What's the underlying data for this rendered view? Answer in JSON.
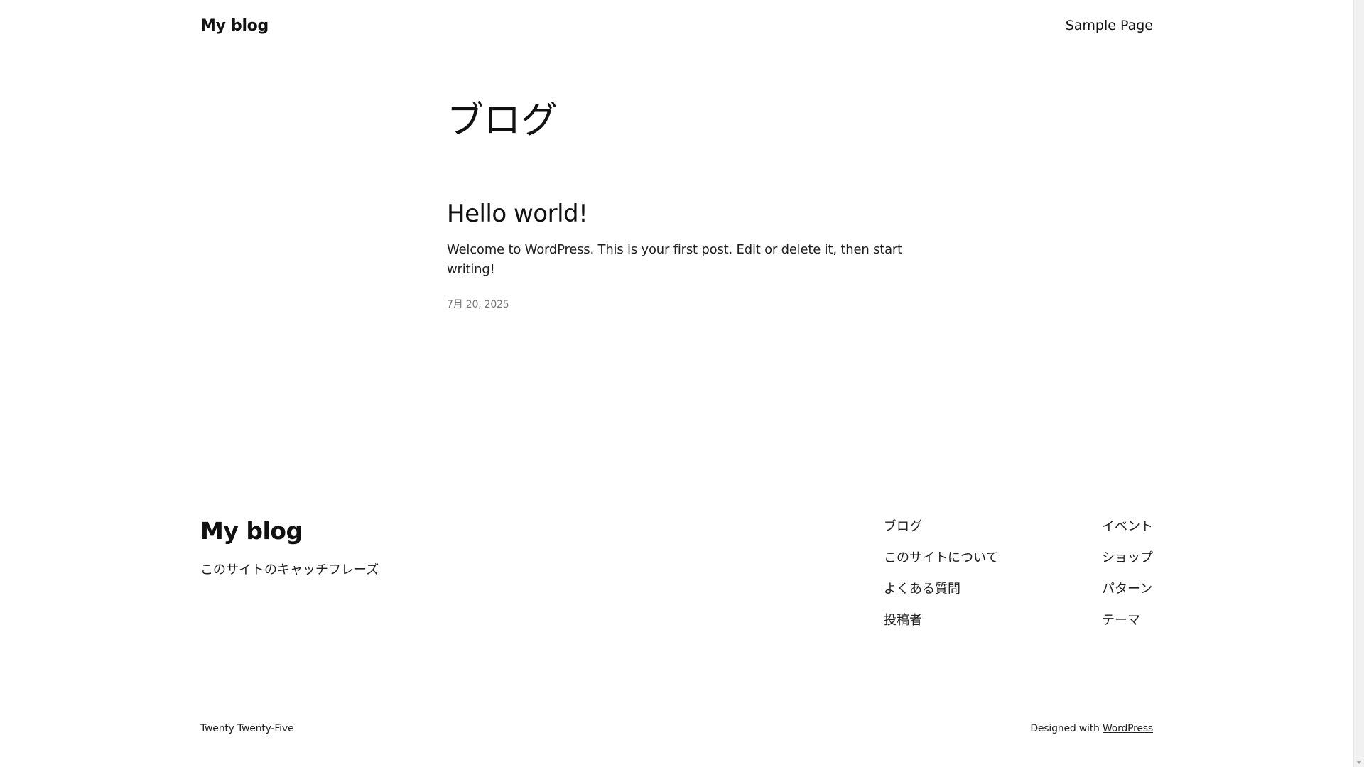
{
  "header": {
    "site_title": "My blog",
    "nav": [
      "Sample Page"
    ]
  },
  "main": {
    "archive_title": "ブログ",
    "posts": [
      {
        "title": "Hello world!",
        "excerpt": "Welcome to WordPress. This is your first post. Edit or delete it, then start writing!",
        "date": "7月 20, 2025"
      }
    ]
  },
  "footer": {
    "site_title": "My blog",
    "tagline": "このサイトのキャッチフレーズ",
    "nav_col1": [
      "ブログ",
      "このサイトについて",
      "よくある質問",
      "投稿者"
    ],
    "nav_col2": [
      "イベント",
      "ショップ",
      "パターン",
      "テーマ"
    ],
    "theme_name": "Twenty Twenty-Five",
    "designed_with": "Designed with",
    "designed_with_link": "WordPress"
  },
  "icons": {
    "scroll_down": "chevron-down-icon"
  }
}
